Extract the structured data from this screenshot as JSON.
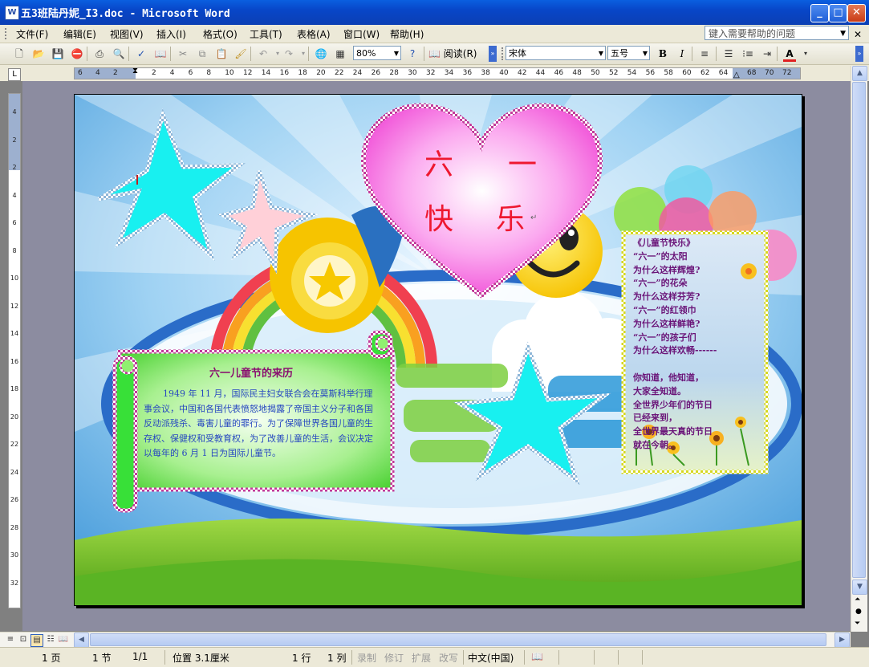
{
  "window": {
    "title": "五3班陆丹妮_I3.doc - Microsoft Word",
    "icon": "word-doc-icon",
    "buttons": [
      "minimize",
      "maximize",
      "close"
    ]
  },
  "menu": {
    "items": [
      "文件(F)",
      "编辑(E)",
      "视图(V)",
      "插入(I)",
      "格式(O)",
      "工具(T)",
      "表格(A)",
      "窗口(W)",
      "帮助(H)"
    ],
    "help_placeholder": "键入需要帮助的问题"
  },
  "toolbar": {
    "zoom": "80%",
    "read_label": "阅读(R)",
    "font": "宋体",
    "font_size": "五号",
    "icons": [
      "new-icon",
      "open-icon",
      "save-icon",
      "permission-icon",
      "print-icon",
      "print-preview-icon",
      "spelling-icon",
      "research-icon",
      "cut-icon",
      "copy-icon",
      "paste-icon",
      "format-painter-icon",
      "undo-icon",
      "redo-icon",
      "hyperlink-icon",
      "table-icon",
      "help-icon",
      "bold-icon",
      "italic-icon",
      "align-icon",
      "numbering-icon",
      "bullets-icon",
      "indent-icon",
      "font-color-icon"
    ],
    "accent_color": "#e02020"
  },
  "ruler": {
    "h_ticks": [
      "6",
      "4",
      "2",
      "2",
      "4",
      "6",
      "8",
      "10",
      "12",
      "14",
      "16",
      "18",
      "20",
      "22",
      "24",
      "26",
      "28",
      "30",
      "32",
      "34",
      "36",
      "38",
      "40",
      "42",
      "44",
      "46",
      "48",
      "50",
      "52",
      "54",
      "56",
      "58",
      "60",
      "62",
      "64",
      "68",
      "70",
      "72"
    ],
    "v_ticks": [
      "4",
      "2",
      "2",
      "4",
      "6",
      "8",
      "10",
      "12",
      "14",
      "16",
      "18",
      "20",
      "22",
      "24",
      "26",
      "28",
      "30",
      "32"
    ]
  },
  "document": {
    "heart": {
      "line1_left": "六",
      "line1_right": "一",
      "line2_left": "快",
      "line2_right": "乐"
    },
    "scroll": {
      "title": "六一儿童节的来历",
      "body": "1949 年 11 月，国际民主妇女联合会在莫斯科举行理事会议，中国和各国代表愤怒地揭露了帝国主义分子和各国反动派残杀、毒害儿童的罪行。为了保障世界各国儿童的生存权、保健权和受教育权，为了改善儿童的生活，会议决定以每年的 6 月 1 日为国际儿童节。"
    },
    "poem": {
      "lines": [
        "《儿童节快乐》",
        "“六一”的太阳",
        "  为什么这样辉煌?",
        "  “六一”的花朵",
        "为什么这样芬芳?",
        "  “六一”的红领巾",
        "为什么这样鲜艳?",
        "  “六一”的孩子们",
        "为什么这样欢畅------",
        "",
        "你知道，他知道，",
        "大家全知道。",
        "全世界少年们的节日",
        "已经来到，",
        "全世界最天真的节日",
        "就在今朝。"
      ]
    }
  },
  "status": {
    "page": "1 页",
    "section": "1 节",
    "page_of": "1/1",
    "position": "位置 3.1厘米",
    "line": "1 行",
    "column": "1 列",
    "rec": "录制",
    "trk": "修订",
    "ext": "扩展",
    "ovr": "改写",
    "language": "中文(中国)"
  }
}
